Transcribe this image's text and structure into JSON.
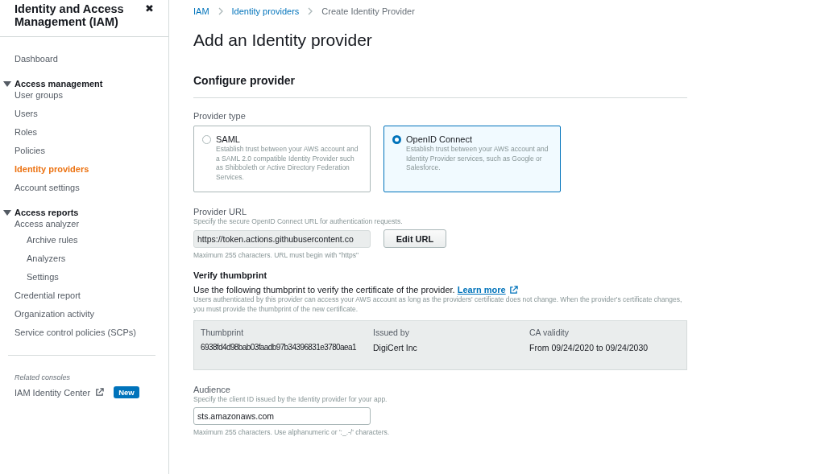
{
  "sidebar": {
    "title": "Identity and Access Management (IAM)",
    "close": "✖",
    "items": [
      {
        "kind": "link",
        "label": "Dashboard",
        "selected": false
      },
      {
        "kind": "section",
        "label": "Access management",
        "expanded": true,
        "children": [
          {
            "label": "User groups",
            "selected": false
          },
          {
            "label": "Users",
            "selected": false
          },
          {
            "label": "Roles",
            "selected": false
          },
          {
            "label": "Policies",
            "selected": false
          },
          {
            "label": "Identity providers",
            "selected": true
          },
          {
            "label": "Account settings",
            "selected": false
          }
        ]
      },
      {
        "kind": "section",
        "label": "Access reports",
        "expanded": true,
        "children": [
          {
            "label": "Access analyzer",
            "selected": false,
            "children": [
              {
                "label": "Archive rules",
                "selected": false
              },
              {
                "label": "Analyzers",
                "selected": false
              },
              {
                "label": "Settings",
                "selected": false
              }
            ]
          },
          {
            "label": "Credential report",
            "selected": false
          },
          {
            "label": "Organization activity",
            "selected": false
          },
          {
            "label": "Service control policies (SCPs)",
            "selected": false
          }
        ]
      }
    ],
    "related": {
      "heading": "Related consoles",
      "label": "IAM Identity Center",
      "badge": "New"
    }
  },
  "breadcrumbs": [
    {
      "label": "IAM",
      "link": true
    },
    {
      "label": "Identity providers",
      "link": true
    },
    {
      "label": "Create Identity Provider",
      "link": false
    }
  ],
  "title": "Add an Identity provider",
  "section_title": "Configure provider",
  "provider_type": {
    "label": "Provider type",
    "options": [
      {
        "label": "SAML",
        "description": "Establish trust between your AWS account and a SAML 2.0 compatible Identity Provider such as Shibboleth or Active Directory Federation Services.",
        "selected": false
      },
      {
        "label": "OpenID Connect",
        "description": "Establish trust between your AWS account and Identity Provider services, such as Google or Salesforce.",
        "selected": true
      }
    ]
  },
  "provider_url": {
    "label": "Provider URL",
    "description": "Specify the secure OpenID Connect URL for authentication requests.",
    "value": "https://token.actions.githubusercontent.co",
    "disabled": true,
    "button": "Edit URL",
    "hint": "Maximum 255 characters. URL must begin with \"https\""
  },
  "thumbprint": {
    "title": "Verify thumbprint",
    "text": "Use the following thumbprint to verify the certificate of the provider.",
    "link": "Learn more",
    "note": "Users authenticated by this provider can access your AWS account as long as the providers' certificate does not change. When the provider's certificate changes, you must provide the thumbprint of the new certificate.",
    "columns": [
      "Thumbprint",
      "Issued by",
      "CA validity"
    ],
    "values": [
      "6938fd4d98bab03faadb97b34396831e3780aea1",
      "DigiCert Inc",
      "From 09/24/2020 to 09/24/2030"
    ]
  },
  "audience": {
    "label": "Audience",
    "description": "Specify the client ID issued by the Identity provider for your app.",
    "value": "sts.amazonaws.com",
    "hint": "Maximum 255 characters. Use alphanumeric or ':_.-/' characters."
  }
}
